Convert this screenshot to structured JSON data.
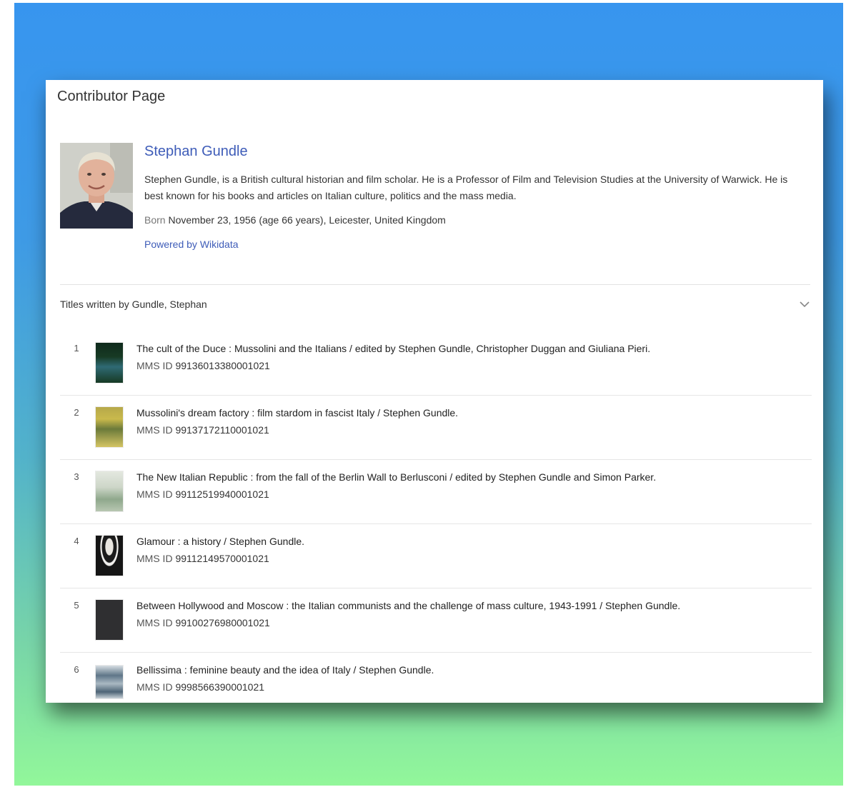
{
  "page": {
    "title": "Contributor Page"
  },
  "author": {
    "name": "Stephan Gundle",
    "bio": "Stephen Gundle, is a British cultural historian and film scholar. He is a Professor of Film and Television Studies at the University of Warwick. He is best known for his books and articles on Italian culture, politics and the mass media.",
    "born_label": "Born",
    "born_value": "November 23, 1956 (age 66 years), Leicester, United Kingdom",
    "powered_by": "Powered by Wikidata"
  },
  "titles_section": {
    "heading": "Titles written by Gundle, Stephan",
    "mms_label": "MMS ID",
    "items": [
      {
        "num": "1",
        "title": "The cult of the Duce : Mussolini and the Italians / edited by Stephen Gundle, Christopher Duggan and Giuliana Pieri.",
        "mms_id": "99136013380001021"
      },
      {
        "num": "2",
        "title": "Mussolini's dream factory : film stardom in fascist Italy / Stephen Gundle.",
        "mms_id": "99137172110001021"
      },
      {
        "num": "3",
        "title": "The New Italian Republic : from the fall of the Berlin Wall to Berlusconi / edited by Stephen Gundle and Simon Parker.",
        "mms_id": "99112519940001021"
      },
      {
        "num": "4",
        "title": "Glamour : a history / Stephen Gundle.",
        "mms_id": "99112149570001021"
      },
      {
        "num": "5",
        "title": "Between Hollywood and Moscow : the Italian communists and the challenge of mass culture, 1943-1991 / Stephen Gundle.",
        "mms_id": "99100276980001021"
      },
      {
        "num": "6",
        "title": "Bellissima : feminine beauty and the idea of Italy / Stephen Gundle.",
        "mms_id": "9998566390001021"
      }
    ]
  },
  "colors": {
    "link": "#3e5cb8",
    "backdrop_top": "#3795ef",
    "backdrop_bottom": "#92f79a"
  },
  "icons": {
    "collapse": "chevron-down-icon"
  }
}
